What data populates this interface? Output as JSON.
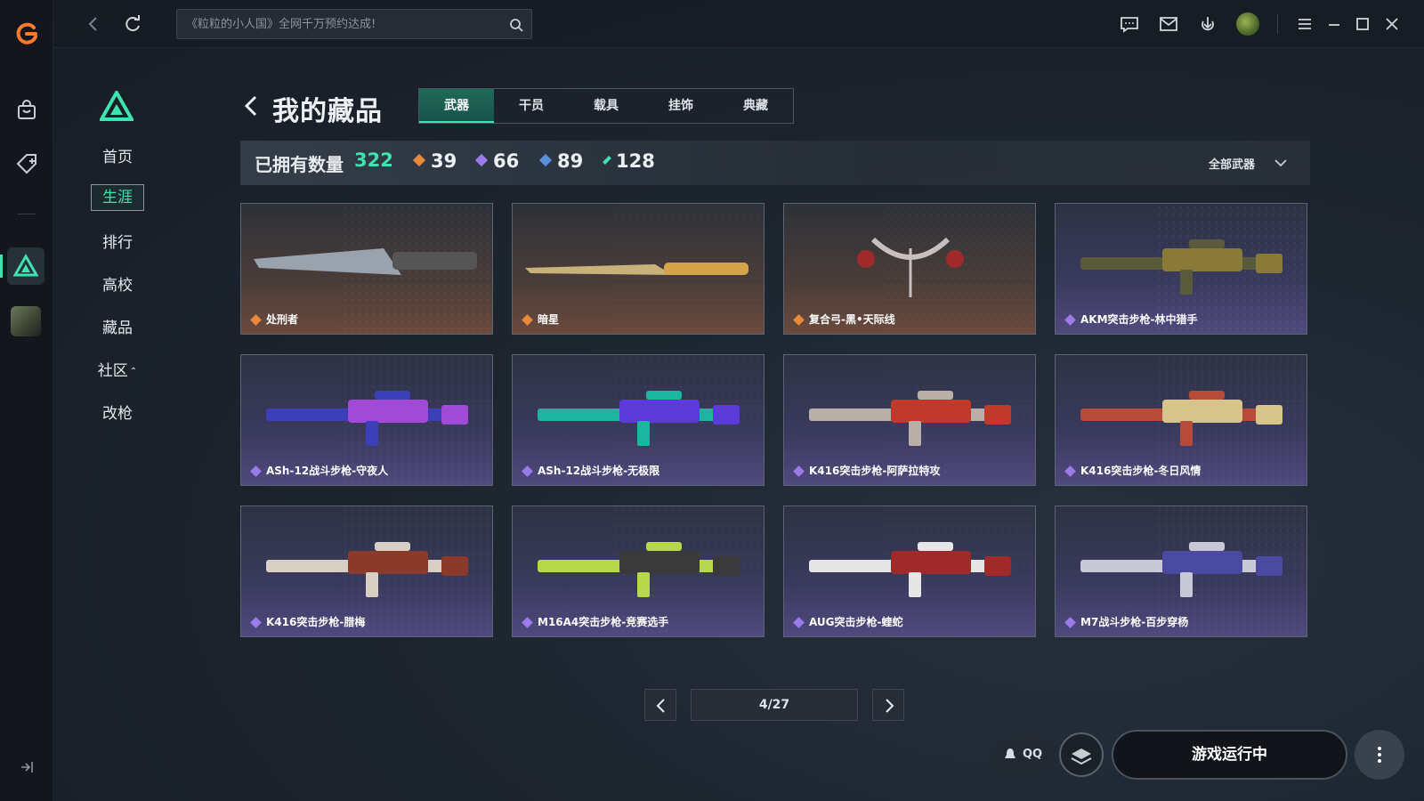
{
  "rail": {
    "logo_color": "#ff7a2f",
    "active_color": "#3fe3b0"
  },
  "topbar": {
    "search_placeholder": "《粒粒的小人国》全网千万预约达成!"
  },
  "sidenav": {
    "items": [
      {
        "label": "首页"
      },
      {
        "label": "生涯",
        "active": true
      },
      {
        "label": "排行"
      },
      {
        "label": "高校"
      },
      {
        "label": "藏品"
      },
      {
        "label": "社区",
        "caret": "⌃"
      },
      {
        "label": "改枪"
      }
    ]
  },
  "header": {
    "title": "我的藏品",
    "tabs": [
      "武器",
      "干员",
      "载具",
      "挂饰",
      "典藏"
    ],
    "active_tab": "武器"
  },
  "stats": {
    "owned_label": "已拥有数量",
    "owned_value": "322",
    "counts": [
      {
        "value": "39",
        "color": "#e88a3a"
      },
      {
        "value": "66",
        "color": "#9b7bea"
      },
      {
        "value": "89",
        "color": "#5a8fe0"
      },
      {
        "value": "128",
        "color": "#3fe3b0"
      }
    ],
    "filter": "全部武器"
  },
  "cards": [
    {
      "name": "处刑者",
      "rarity": "gold"
    },
    {
      "name": "暗星",
      "rarity": "gold"
    },
    {
      "name": "复合弓-黑•天际线",
      "rarity": "gold"
    },
    {
      "name": "AKM突击步枪-林中猎手",
      "rarity": "purple"
    },
    {
      "name": "ASh-12战斗步枪-守夜人",
      "rarity": "purple"
    },
    {
      "name": "ASh-12战斗步枪-无极限",
      "rarity": "purple"
    },
    {
      "name": "K416突击步枪-阿萨拉特攻",
      "rarity": "purple"
    },
    {
      "name": "K416突击步枪-冬日风情",
      "rarity": "purple"
    },
    {
      "name": "K416突击步枪-腊梅",
      "rarity": "purple"
    },
    {
      "name": "M16A4突击步枪-竞赛选手",
      "rarity": "purple"
    },
    {
      "name": "AUG突击步枪-蝰蛇",
      "rarity": "purple"
    },
    {
      "name": "M7战斗步枪-百步穿杨",
      "rarity": "purple"
    }
  ],
  "pagination": {
    "page": "4/27"
  },
  "bottom": {
    "qq_label": "QQ",
    "run_label": "游戏运行中"
  },
  "colors": {
    "accent": "#3fe3b0",
    "gold": "#e88a3a",
    "purple": "#9b7bea"
  }
}
